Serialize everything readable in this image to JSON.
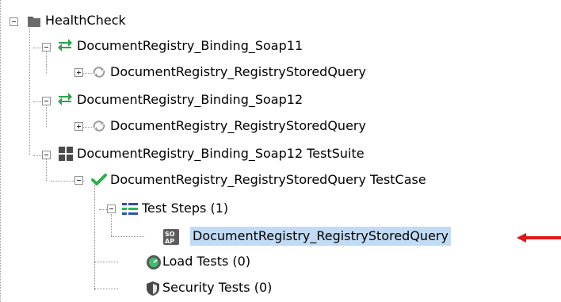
{
  "tree": {
    "root": {
      "label": "HealthCheck",
      "icon": "folder-icon"
    },
    "nodes": [
      {
        "id": "n1",
        "label": "DocumentRegistry_Binding_Soap11",
        "icon": "interface-arrows-icon"
      },
      {
        "id": "n2",
        "label": "DocumentRegistry_RegistryStoredQuery",
        "icon": "operation-refresh-icon"
      },
      {
        "id": "n3",
        "label": "DocumentRegistry_Binding_Soap12",
        "icon": "interface-arrows-icon"
      },
      {
        "id": "n4",
        "label": "DocumentRegistry_RegistryStoredQuery",
        "icon": "operation-refresh-icon"
      },
      {
        "id": "n5",
        "label": "DocumentRegistry_Binding_Soap12 TestSuite",
        "icon": "testsuite-grid-icon"
      },
      {
        "id": "n6",
        "label": "DocumentRegistry_RegistryStoredQuery TestCase",
        "icon": "checkmark-icon"
      },
      {
        "id": "n7",
        "label": "Test Steps (1)",
        "icon": "teststeps-list-icon"
      },
      {
        "id": "n8",
        "label": "DocumentRegistry_RegistryStoredQuery",
        "icon": "soap-request-icon",
        "selected": true
      },
      {
        "id": "n9",
        "label": "Load Tests (0)",
        "icon": "load-test-gauge-icon"
      },
      {
        "id": "n10",
        "label": "Security Tests (0)",
        "icon": "security-shield-icon"
      }
    ]
  },
  "colors": {
    "selection": "#c2dbf5",
    "interface_green": "#2aa64a",
    "checkmark_green": "#2fae4e",
    "pointer_red": "#e01818",
    "grid_dark": "#4a4a4a",
    "steps_blue": "#2b4fb5"
  },
  "pointer": {
    "icon": "red-arrow-icon"
  }
}
